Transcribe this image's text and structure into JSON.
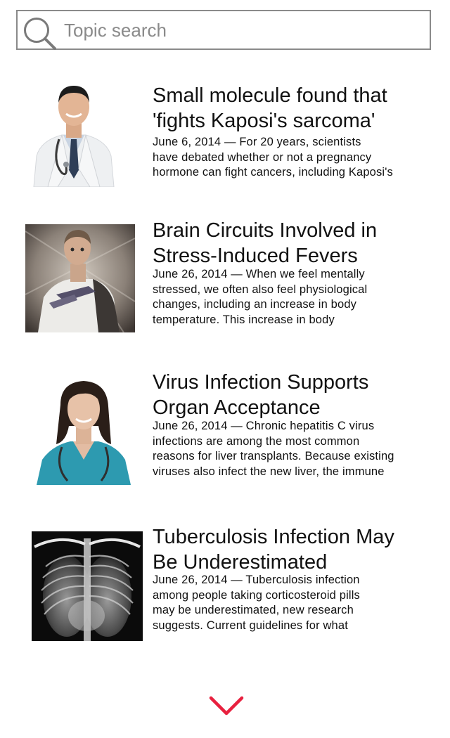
{
  "search": {
    "placeholder": "Topic search"
  },
  "articles": [
    {
      "title": "Small molecule found that\n'fights Kaposi's sarcoma'",
      "excerpt": "June 6, 2014 — For 20 years, scientists\nhave debated whether or not a pregnancy\nhormone can fight cancers, including Kaposi's"
    },
    {
      "title": "Brain Circuits Involved in\nStress-Induced Fevers",
      "excerpt": "June 26, 2014 — When we feel mentally\nstressed, we often also feel physiological\nchanges, including an increase in body\ntemperature. This increase in body"
    },
    {
      "title": "Virus Infection Supports\nOrgan Acceptance",
      "excerpt": "June 26, 2014 — Chronic hepatitis C virus\ninfections are among the most common\nreasons for liver transplants. Because existing\nviruses also infect the new liver, the immune"
    },
    {
      "title": "Tuberculosis Infection May\nBe Underestimated",
      "excerpt": "June 26, 2014 — Tuberculosis infection\namong people taking corticosteroid pills\nmay be underestimated, new research\nsuggests. Current guidelines for what"
    }
  ],
  "icons": {
    "search": "search-icon",
    "load_more": "chevron-down-icon"
  },
  "colors": {
    "accent": "#e8213f",
    "border": "#8a8a8a",
    "placeholder": "#8a8a8a"
  }
}
